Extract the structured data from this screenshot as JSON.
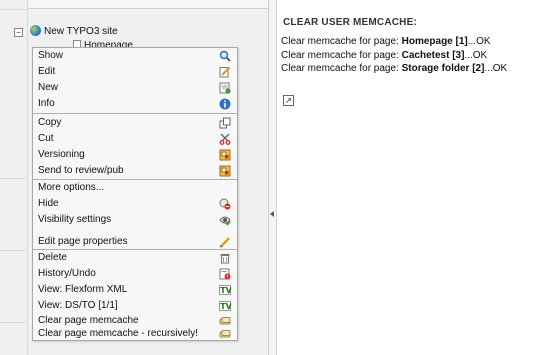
{
  "tree": {
    "root_label": "New TYPO3 site",
    "child_label": "Homepage",
    "toggle_symbol": "−"
  },
  "context_menu": {
    "items": [
      {
        "label": "Show",
        "icon": "magnifier-icon"
      },
      {
        "label": "Edit",
        "icon": "edit-pencil-icon"
      },
      {
        "label": "New",
        "icon": "new-record-icon"
      },
      {
        "label": "Info",
        "icon": "info-icon"
      },
      {
        "label": "Copy",
        "icon": "copy-icon"
      },
      {
        "label": "Cut",
        "icon": "scissors-icon"
      },
      {
        "label": "Versioning",
        "icon": "versioning-icon"
      },
      {
        "label": "Send to review/pub",
        "icon": "workspace-icon"
      },
      {
        "label": "More options...",
        "icon": ""
      },
      {
        "label": "Hide",
        "icon": "hide-icon"
      },
      {
        "label": "Visibility settings",
        "icon": "visibility-icon"
      },
      {
        "label": "Edit page properties",
        "icon": "pencil-icon"
      },
      {
        "label": "Delete",
        "icon": "trash-icon"
      },
      {
        "label": "History/Undo",
        "icon": "history-icon"
      },
      {
        "label": "View: Flexform XML",
        "icon": "templavoila-icon"
      },
      {
        "label": "View: DS/TO [1/1]",
        "icon": "templavoila-icon"
      },
      {
        "label": "Clear page memcache",
        "icon": "memcache-icon"
      },
      {
        "label": "Clear page memcache - recursively!",
        "icon": "memcache-icon"
      }
    ]
  },
  "content": {
    "title": "CLEAR USER MEMCACHE:",
    "results": [
      {
        "prefix": "Clear memcache for page: ",
        "page": "Homepage [1]",
        "status": "...OK"
      },
      {
        "prefix": "Clear memcache for page: ",
        "page": "Cachetest [3]",
        "status": "...OK"
      },
      {
        "prefix": "Clear memcache for page: ",
        "page": "Storage folder [2]",
        "status": "...OK"
      }
    ],
    "shortcut_symbol": "↗"
  }
}
